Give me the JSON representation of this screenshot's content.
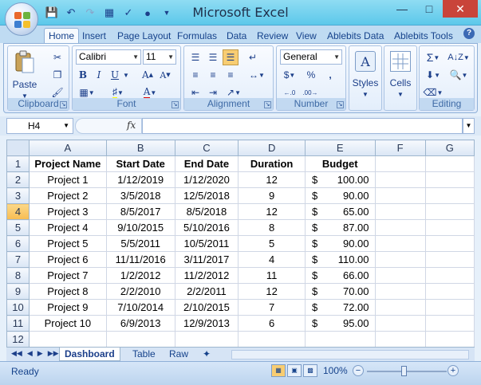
{
  "window": {
    "title": "Microsoft Excel"
  },
  "ribbon": {
    "tabs": [
      "Home",
      "Insert",
      "Page Layout",
      "Formulas",
      "Data",
      "Review",
      "View",
      "Ablebits Data",
      "Ablebits Tools"
    ],
    "active_tab": "Home",
    "groups": {
      "clipboard": {
        "label": "Clipboard",
        "paste_label": "Paste"
      },
      "font": {
        "label": "Font",
        "font_name": "Calibri",
        "font_size": "11"
      },
      "alignment": {
        "label": "Alignment"
      },
      "number": {
        "label": "Number",
        "format": "General",
        "currency": "$",
        "percent": "%",
        "comma": ","
      },
      "styles": {
        "label": "Styles"
      },
      "cells": {
        "label": "Cells"
      },
      "editing": {
        "label": "Editing"
      }
    }
  },
  "formula_bar": {
    "name_box": "H4",
    "fx": "fx",
    "formula": ""
  },
  "sheet": {
    "columns": [
      "A",
      "B",
      "C",
      "D",
      "E",
      "F",
      "G"
    ],
    "selected_row": 4,
    "headers": [
      "Project Name",
      "Start Date",
      "End Date",
      "Duration",
      "Budget"
    ],
    "rows": [
      {
        "n": "2",
        "name": "Project 1",
        "start": "1/12/2019",
        "end": "1/12/2020",
        "dur": "12",
        "cur": "$",
        "budget": "100.00"
      },
      {
        "n": "3",
        "name": "Project 2",
        "start": "3/5/2018",
        "end": "12/5/2018",
        "dur": "9",
        "cur": "$",
        "budget": "90.00"
      },
      {
        "n": "4",
        "name": "Project 3",
        "start": "8/5/2017",
        "end": "8/5/2018",
        "dur": "12",
        "cur": "$",
        "budget": "65.00"
      },
      {
        "n": "5",
        "name": "Project 4",
        "start": "9/10/2015",
        "end": "5/10/2016",
        "dur": "8",
        "cur": "$",
        "budget": "87.00"
      },
      {
        "n": "6",
        "name": "Project 5",
        "start": "5/5/2011",
        "end": "10/5/2011",
        "dur": "5",
        "cur": "$",
        "budget": "90.00"
      },
      {
        "n": "7",
        "name": "Project 6",
        "start": "11/11/2016",
        "end": "3/11/2017",
        "dur": "4",
        "cur": "$",
        "budget": "110.00"
      },
      {
        "n": "8",
        "name": "Project 7",
        "start": "1/2/2012",
        "end": "11/2/2012",
        "dur": "11",
        "cur": "$",
        "budget": "66.00"
      },
      {
        "n": "9",
        "name": "Project 8",
        "start": "2/2/2010",
        "end": "2/2/2011",
        "dur": "12",
        "cur": "$",
        "budget": "70.00"
      },
      {
        "n": "10",
        "name": "Project 9",
        "start": "7/10/2014",
        "end": "2/10/2015",
        "dur": "7",
        "cur": "$",
        "budget": "72.00"
      },
      {
        "n": "11",
        "name": "Project 10",
        "start": "6/9/2013",
        "end": "12/9/2013",
        "dur": "6",
        "cur": "$",
        "budget": "95.00"
      }
    ],
    "row_numbers": {
      "header": "1",
      "empty": "12"
    },
    "tabs": [
      "Dashboard",
      "Table",
      "Raw"
    ],
    "active_tab": "Dashboard"
  },
  "status_bar": {
    "status": "Ready",
    "zoom": "100%"
  }
}
